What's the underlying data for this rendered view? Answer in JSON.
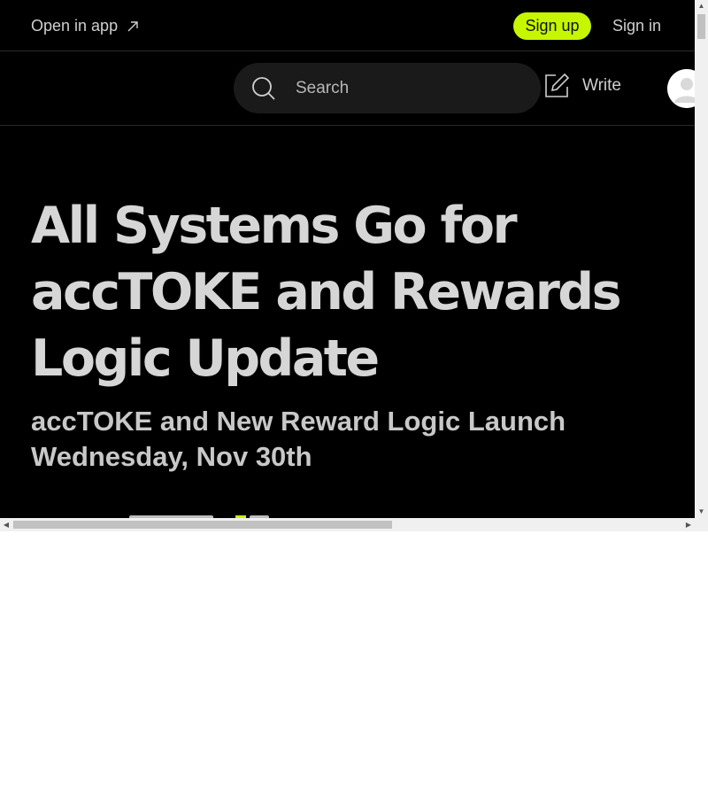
{
  "topbar": {
    "open_in_app": "Open in app",
    "sign_up": "Sign up",
    "sign_in": "Sign in"
  },
  "header": {
    "search_placeholder": "Search",
    "write_label": "Write"
  },
  "article": {
    "title": "All Systems Go for accTOKE and Rewards Logic Update",
    "subtitle": "accTOKE and New Reward Logic Launch Wednesday, Nov 30th"
  },
  "colors": {
    "background": "#000000",
    "accent": "#c6f600",
    "text": "#d6d6d6"
  },
  "icons": [
    "arrow-up-right-icon",
    "search-icon",
    "write-icon",
    "avatar-icon"
  ]
}
